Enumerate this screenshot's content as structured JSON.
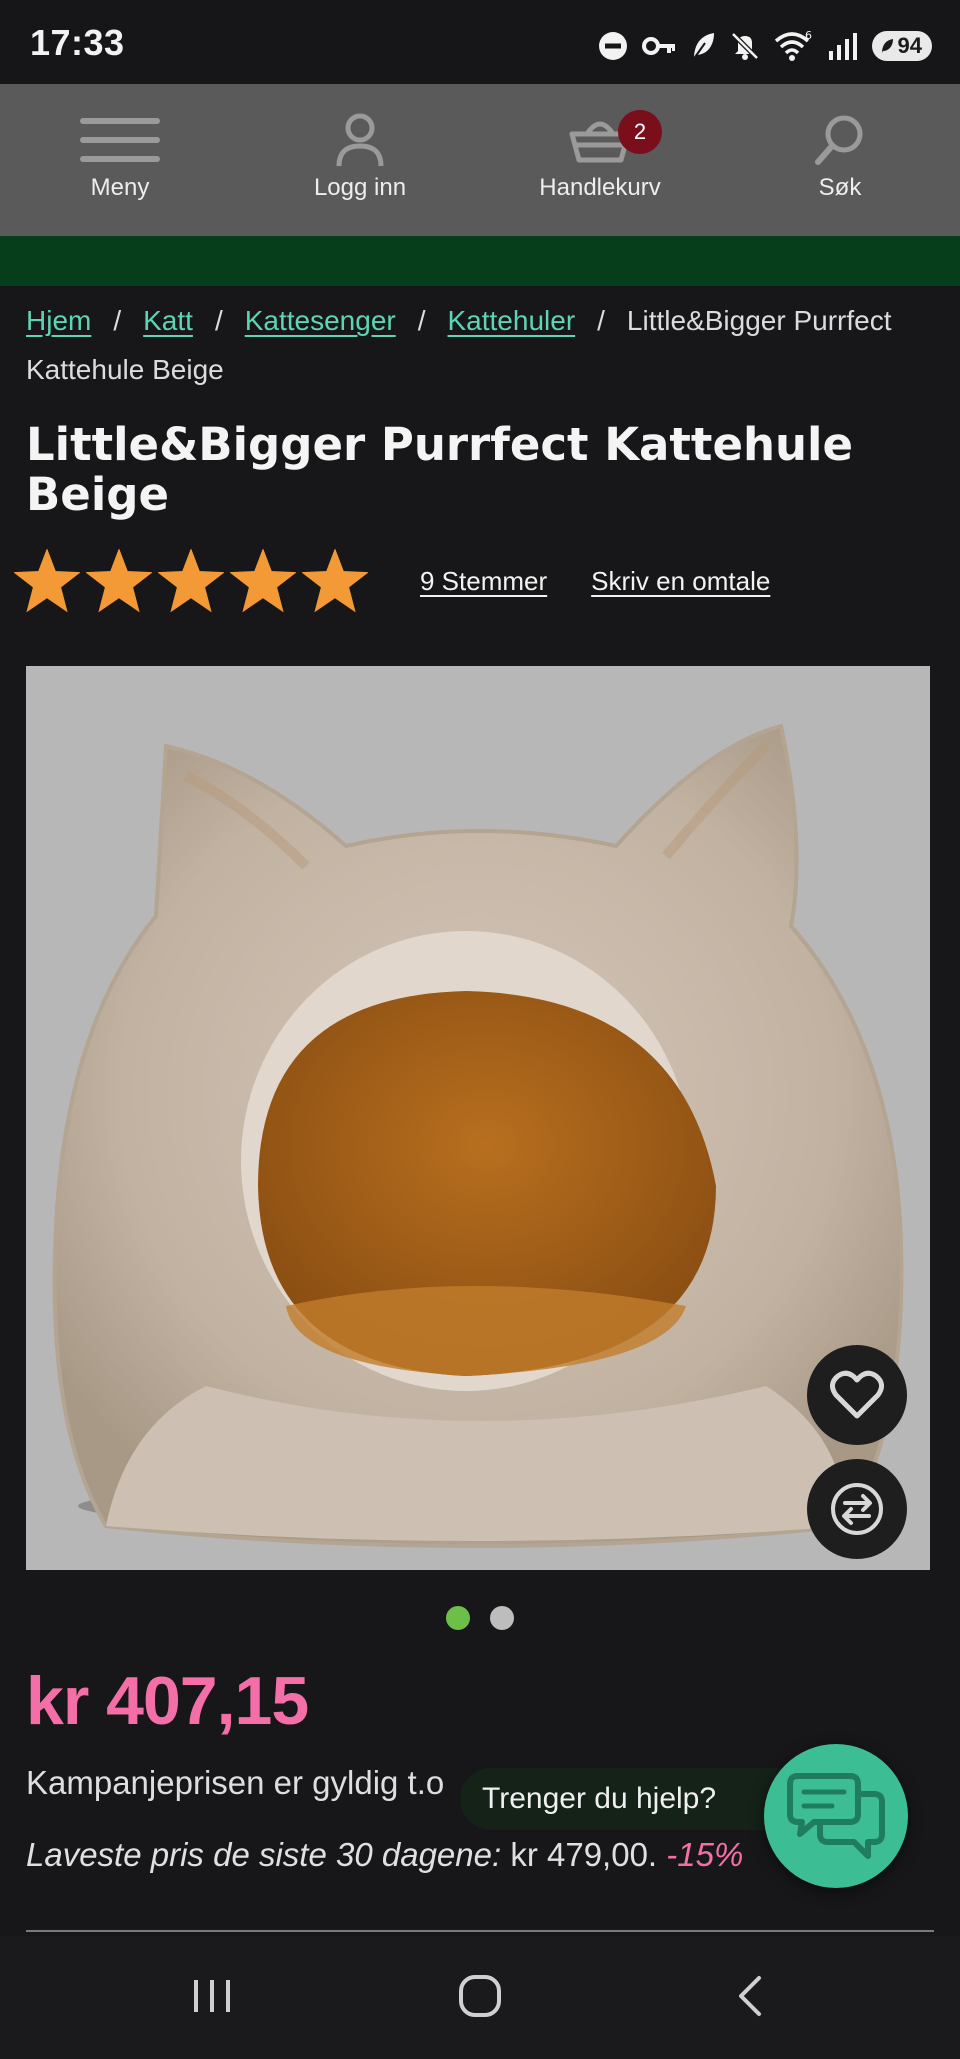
{
  "status_bar": {
    "time": "17:33",
    "battery": "94",
    "icons": [
      "do-not-disturb-icon",
      "vpn-key-icon",
      "leaf-icon",
      "mute-icon",
      "wifi-icon",
      "signal-icon",
      "battery-icon"
    ]
  },
  "nav": {
    "menu_label": "Meny",
    "login_label": "Logg inn",
    "cart_label": "Handlekurv",
    "cart_count": "2",
    "search_label": "Søk"
  },
  "breadcrumb": {
    "items": [
      "Hjem",
      "Katt",
      "Kattesenger",
      "Kattehuler"
    ],
    "current": "Little&Bigger Purrfect Kattehule Beige",
    "separator": "/"
  },
  "product": {
    "title": "Little&Bigger Purrfect Kattehule Beige",
    "rating": 5,
    "rating_max": 5,
    "votes_label": "9 Stemmer",
    "write_review_label": "Skriv en omtale",
    "image_icon": "cat-cave-bed-image",
    "favorite_icon": "heart-icon",
    "compare_icon": "compare-arrows-icon",
    "image_count": 2,
    "image_active_index": 0,
    "price": "kr 407,15",
    "campaign_text": "Kampanjeprisen er gyldig t.o",
    "lowest_label": "Laveste pris de siste 30 dagene:",
    "lowest_value": "kr 479,00.",
    "discount": "-15%"
  },
  "chat": {
    "help_text": "Trenger du hjelp?",
    "icon": "chat-bubbles-icon"
  },
  "colors": {
    "accent_link": "#5fd3b4",
    "price": "#f46fa7",
    "star": "#f39a36",
    "green_bar": "#063d1b",
    "chat": "#3dbd94",
    "dot_active": "#6cc04a",
    "dot_inactive": "#bdbdbd"
  }
}
